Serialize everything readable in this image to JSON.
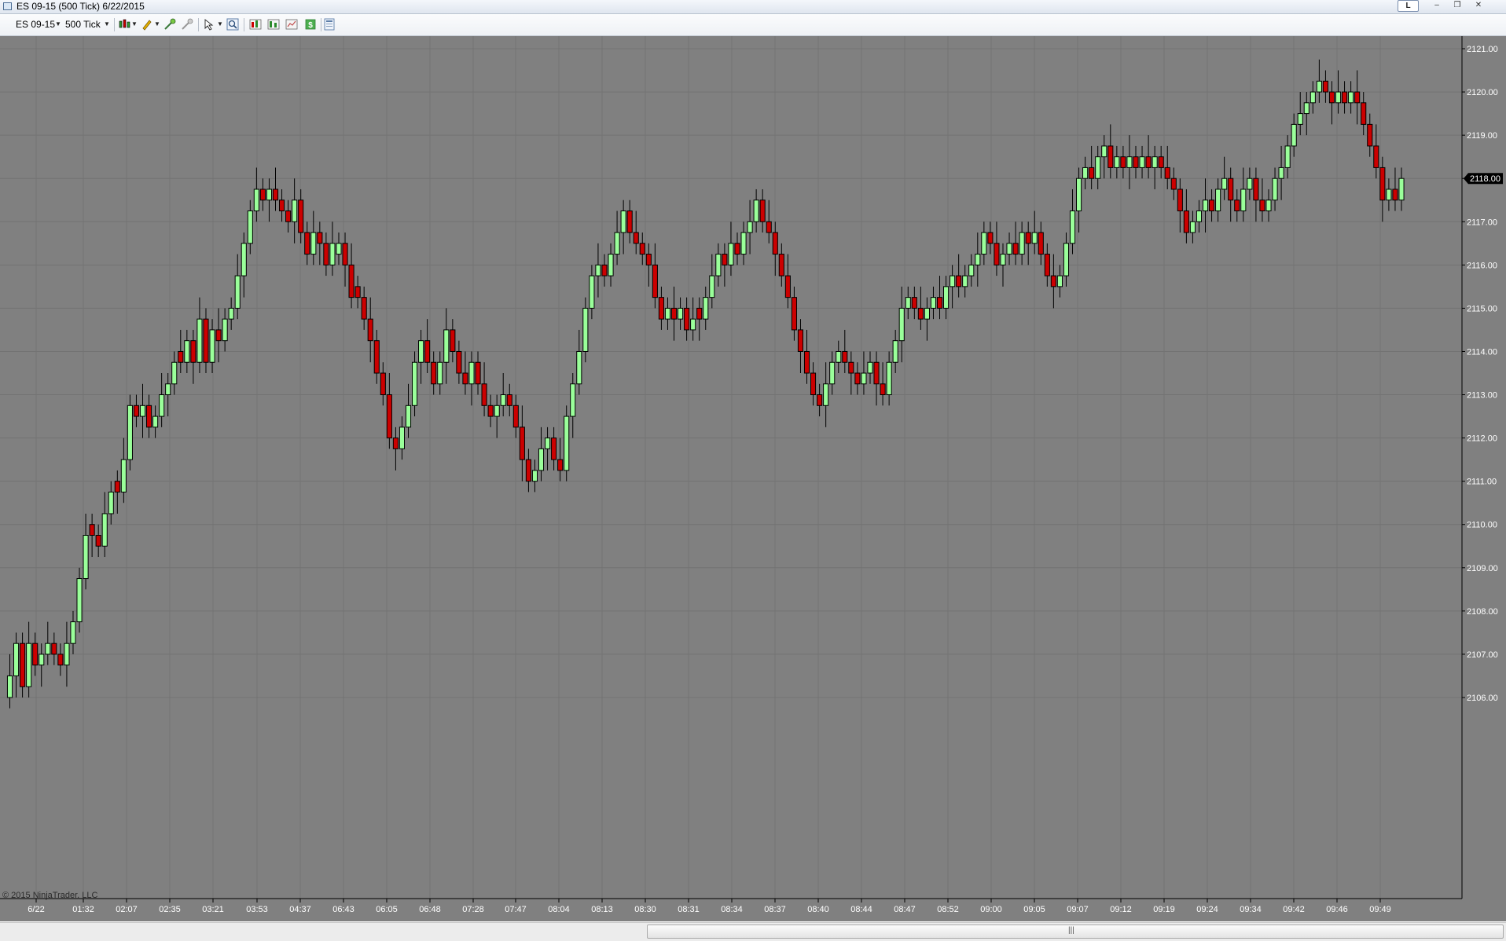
{
  "window": {
    "title": "ES 09-15 (500 Tick)  6/22/2015",
    "l_button": "L",
    "min_glyph": "–",
    "max_glyph": "❐",
    "close_glyph": "✕"
  },
  "toolbar": {
    "instrument": "ES 09-15",
    "interval": "500 Tick",
    "icons": [
      "candlestick-style-icon",
      "drawing-pencil-icon",
      "draw-tools-icon",
      "global-draw-icon",
      "cursor-pointer-icon",
      "zoom-icon",
      "indicators-icon",
      "strategies-icon",
      "data-box-icon",
      "dollar-icon",
      "properties-icon"
    ]
  },
  "chart": {
    "copyright": "© 2015 NinjaTrader, LLC",
    "last_price_label": "2118.00",
    "colors": {
      "background": "#808080",
      "up": "#9aff9a",
      "down": "#cc0000",
      "grid": "#737373",
      "wick": "#000000",
      "axis_text": "#ffffff"
    }
  },
  "chart_data": {
    "type": "candlestick",
    "title": "ES 09-15 (500 Tick)  6/22/2015",
    "ylim": [
      2105.5,
      2121.25
    ],
    "tick_size": 0.25,
    "y_ticks": [
      "2106.00",
      "2107.00",
      "2108.00",
      "2109.00",
      "2110.00",
      "2111.00",
      "2112.00",
      "2113.00",
      "2114.00",
      "2115.00",
      "2116.00",
      "2117.00",
      "2118.00",
      "2119.00",
      "2120.00",
      "2121.00"
    ],
    "x_tick_labels": [
      "6/22",
      "01:32",
      "02:07",
      "02:35",
      "03:21",
      "03:53",
      "04:37",
      "06:43",
      "06:05",
      "06:48",
      "07:28",
      "07:47",
      "08:04",
      "08:13",
      "08:30",
      "08:31",
      "08:34",
      "08:37",
      "08:40",
      "08:44",
      "08:47",
      "08:52",
      "09:00",
      "09:05",
      "09:07",
      "09:12",
      "09:19",
      "09:24",
      "09:34",
      "09:42",
      "09:46",
      "09:49"
    ],
    "closes": [
      2106.5,
      2107.25,
      2106.25,
      2107.25,
      2106.75,
      2107.0,
      2107.25,
      2107.0,
      2106.75,
      2107.25,
      2107.75,
      2108.75,
      2109.75,
      2109.75,
      2109.5,
      2110.25,
      2110.75,
      2110.75,
      2111.5,
      2112.75,
      2112.5,
      2112.75,
      2112.25,
      2112.5,
      2113.0,
      2113.25,
      2113.75,
      2113.75,
      2114.25,
      2113.75,
      2114.75,
      2113.75,
      2114.5,
      2114.25,
      2114.75,
      2115.0,
      2115.75,
      2116.5,
      2117.25,
      2117.75,
      2117.5,
      2117.75,
      2117.5,
      2117.25,
      2117.0,
      2117.5,
      2116.75,
      2116.25,
      2116.75,
      2116.5,
      2116.0,
      2116.5,
      2116.5,
      2116.0,
      2115.25,
      2115.25,
      2114.75,
      2114.25,
      2113.5,
      2113.0,
      2112.0,
      2111.75,
      2112.25,
      2112.75,
      2113.75,
      2114.25,
      2113.75,
      2113.25,
      2113.75,
      2114.5,
      2114.0,
      2113.5,
      2113.25,
      2113.75,
      2113.25,
      2112.75,
      2112.5,
      2112.75,
      2113.0,
      2112.75,
      2112.25,
      2111.5,
      2111.0,
      2111.25,
      2111.75,
      2112.0,
      2111.5,
      2111.25,
      2112.5,
      2113.25,
      2114.0,
      2115.0,
      2115.75,
      2116.0,
      2115.75,
      2116.25,
      2116.75,
      2117.25,
      2116.75,
      2116.5,
      2116.25,
      2116.0,
      2115.25,
      2114.75,
      2115.0,
      2114.75,
      2115.0,
      2114.5,
      2114.75,
      2114.75,
      2115.25,
      2115.75,
      2116.25,
      2116.0,
      2116.5,
      2116.25,
      2116.75,
      2117.0,
      2117.5,
      2117.0,
      2116.75,
      2116.25,
      2115.75,
      2115.25,
      2114.5,
      2114.0,
      2113.5,
      2113.0,
      2112.75,
      2113.25,
      2113.75,
      2114.0,
      2113.75,
      2113.5,
      2113.25,
      2113.5,
      2113.75,
      2113.25,
      2113.0,
      2113.75,
      2114.25,
      2115.0,
      2115.25,
      2115.0,
      2114.75,
      2115.0,
      2115.25,
      2115.0,
      2115.5,
      2115.75,
      2115.5,
      2115.75,
      2116.0,
      2116.25,
      2116.75,
      2116.5,
      2116.0,
      2116.25,
      2116.5,
      2116.25,
      2116.75,
      2116.5,
      2116.75,
      2116.25,
      2115.75,
      2115.5,
      2115.75,
      2116.5,
      2117.25,
      2118.0,
      2118.25,
      2118.0,
      2118.5,
      2118.75,
      2118.25,
      2118.5,
      2118.25,
      2118.5,
      2118.25,
      2118.5,
      2118.25,
      2118.5,
      2118.25,
      2118.0,
      2117.75,
      2117.25,
      2116.75,
      2117.0,
      2117.25,
      2117.5,
      2117.25,
      2117.75,
      2118.0,
      2117.5,
      2117.25,
      2117.75,
      2118.0,
      2117.5,
      2117.25,
      2117.5,
      2118.0,
      2118.25,
      2118.75,
      2119.25,
      2119.5,
      2119.75,
      2120.0,
      2120.25,
      2120.0,
      2119.75,
      2120.0,
      2119.75,
      2120.0,
      2119.75,
      2119.25,
      2118.75,
      2118.25,
      2117.5,
      2117.75,
      2117.5,
      2118.0
    ]
  }
}
